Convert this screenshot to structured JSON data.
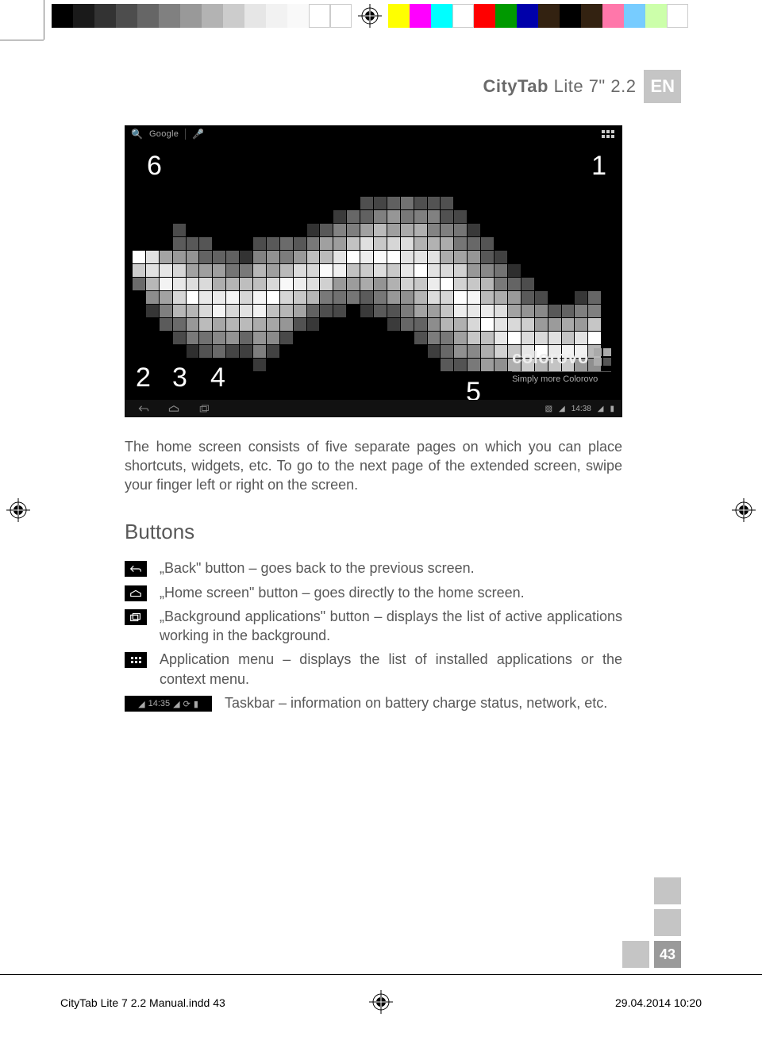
{
  "header": {
    "product_bold": "CityTab",
    "product_light": "Lite 7\" 2.2",
    "lang": "EN"
  },
  "tablet": {
    "search_brand": "Google",
    "brand_word": "colorovo",
    "brand_tag": "Simply more Colorovo",
    "labels": {
      "one": "1",
      "two": "2",
      "three": "3",
      "four": "4",
      "five": "5",
      "six": "6"
    },
    "clock_top": "14:38"
  },
  "body": {
    "intro": "The home screen consists of five separate pages on which you can place shortcuts, widgets, etc. To go to the next page of the extended screen, swipe your finger left or right on the screen.",
    "heading": "Buttons",
    "items": {
      "back": "„Back\" button – goes back to the previous screen.",
      "home": "„Home screen\" button – goes directly to the home screen.",
      "recent": "„Background applications\" button – displays the list of active applications working in the background.",
      "apps": "Application menu – displays the list of installed applications or the context menu.",
      "taskbar_clock": "14:35",
      "taskbar": "Taskbar – information on battery charge status, network, etc."
    }
  },
  "page_number": "43",
  "indd": {
    "file": "CityTab Lite 7 2.2 Manual.indd   43",
    "datetime": "29.04.2014   10:20"
  }
}
